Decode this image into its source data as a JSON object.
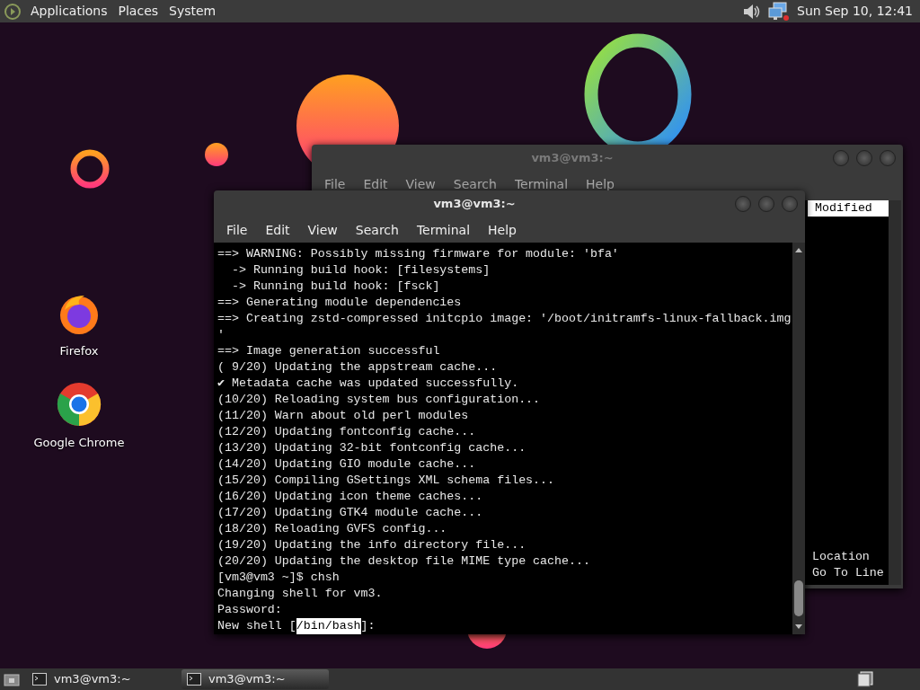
{
  "top_panel": {
    "menus": [
      "Applications",
      "Places",
      "System"
    ],
    "clock": "Sun Sep 10, 12:41"
  },
  "desktop_icons": [
    {
      "label": "Firefox",
      "kind": "firefox"
    },
    {
      "label": "Google Chrome",
      "kind": "chrome"
    }
  ],
  "back_window": {
    "title": "vm3@vm3:~",
    "menu": [
      "File",
      "Edit",
      "View",
      "Search",
      "Terminal",
      "Help"
    ],
    "column_header": "Modified",
    "lines": [
      "Location",
      "Go To Line"
    ]
  },
  "front_window": {
    "title": "vm3@vm3:~",
    "menu": [
      "File",
      "Edit",
      "View",
      "Search",
      "Terminal",
      "Help"
    ],
    "lines": [
      "==> WARNING: Possibly missing firmware for module: 'bfa'",
      "  -> Running build hook: [filesystems]",
      "  -> Running build hook: [fsck]",
      "==> Generating module dependencies",
      "==> Creating zstd-compressed initcpio image: '/boot/initramfs-linux-fallback.img",
      "'",
      "==> Image generation successful",
      "( 9/20) Updating the appstream cache...",
      "✔ Metadata cache was updated successfully.",
      "(10/20) Reloading system bus configuration...",
      "(11/20) Warn about old perl modules",
      "(12/20) Updating fontconfig cache...",
      "(13/20) Updating 32-bit fontconfig cache...",
      "(14/20) Updating GIO module cache...",
      "(15/20) Compiling GSettings XML schema files...",
      "(16/20) Updating icon theme caches...",
      "(17/20) Updating GTK4 module cache...",
      "(18/20) Reloading GVFS config...",
      "(19/20) Updating the info directory file...",
      "(20/20) Updating the desktop file MIME type cache...",
      "[vm3@vm3 ~]$ chsh",
      "Changing shell for vm3.",
      "Password:"
    ],
    "input_line": {
      "prompt": "New shell [",
      "selection": "/bin/bash",
      "suffix": "]:"
    }
  },
  "taskbar": {
    "tasks": [
      {
        "label": "vm3@vm3:~",
        "selected": false
      },
      {
        "label": "vm3@vm3:~",
        "selected": true
      }
    ]
  }
}
